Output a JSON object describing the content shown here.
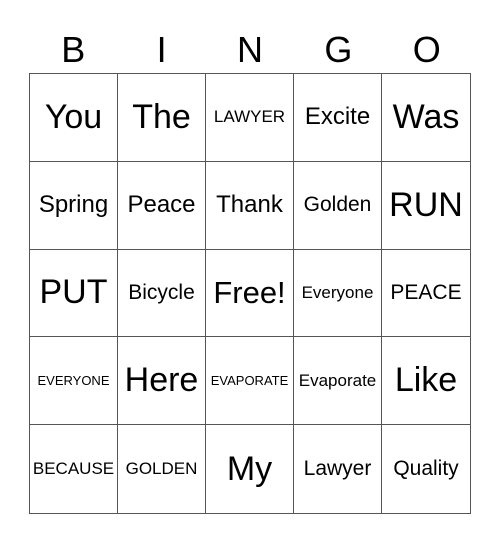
{
  "header": [
    "B",
    "I",
    "N",
    "G",
    "O"
  ],
  "cells": [
    "You",
    "The",
    "LAWYER",
    "Excite",
    "Was",
    "Spring",
    "Peace",
    "Thank",
    "Golden",
    "RUN",
    "PUT",
    "Bicycle",
    "Free!",
    "Everyone",
    "PEACE",
    "EVERYONE",
    "Here",
    "EVAPORATE",
    "Evaporate",
    "Like",
    "BECAUSE",
    "GOLDEN",
    "My",
    "Lawyer",
    "Quality"
  ]
}
